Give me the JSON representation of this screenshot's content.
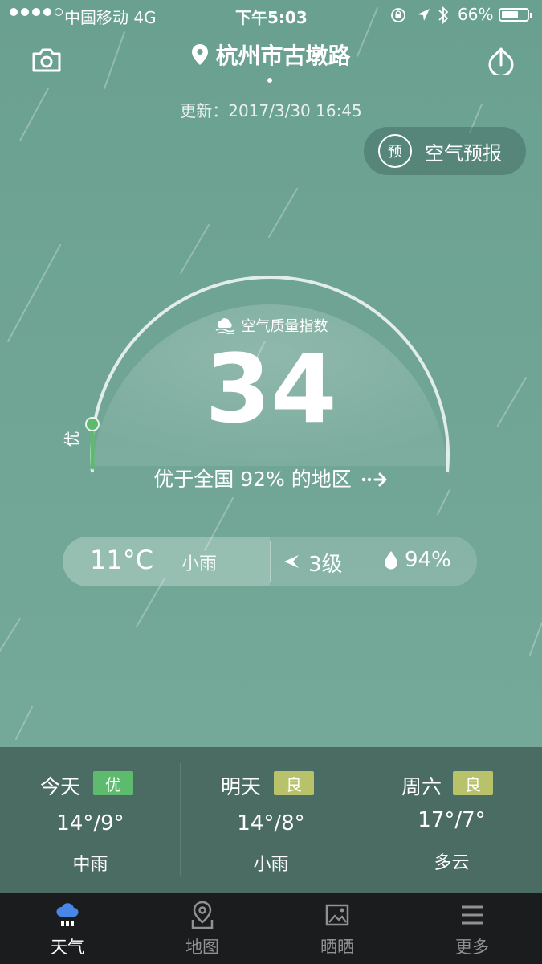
{
  "status_bar": {
    "carrier": "中国移动  4G",
    "time": "下午5:03",
    "battery": "66%",
    "battery_level": 0.66
  },
  "header": {
    "location": "杭州市古墩路",
    "update_time": "更新：2017/3/30 16:45",
    "forecast_button_icon_text": "预",
    "forecast_button_label": "空气预报"
  },
  "aqi": {
    "label": "空气质量指数",
    "value": "34",
    "grade": "优",
    "comparison": "优于全国 92% 的地区"
  },
  "current": {
    "temperature": "11°C",
    "weather": "小雨",
    "wind": "3级",
    "humidity": "94%"
  },
  "forecast": [
    {
      "day": "今天",
      "quality": "优",
      "quality_color": "#5dbb6e",
      "range": "14°/9°",
      "weather": "中雨"
    },
    {
      "day": "明天",
      "quality": "良",
      "quality_color": "#b7c26a",
      "range": "14°/8°",
      "weather": "小雨"
    },
    {
      "day": "周六",
      "quality": "良",
      "quality_color": "#b7c26a",
      "range": "17°/7°",
      "weather": "多云"
    }
  ],
  "tabs": [
    {
      "label": "天气",
      "icon": "weather-cloud-icon",
      "active": true
    },
    {
      "label": "地图",
      "icon": "map-pin-icon",
      "active": false
    },
    {
      "label": "晒晒",
      "icon": "photo-icon",
      "active": false
    },
    {
      "label": "更多",
      "icon": "menu-icon",
      "active": false
    }
  ],
  "colors": {
    "background": "#6ea393",
    "forecast_strip": "#4b6c62",
    "tab_bar": "#1b1c1d",
    "aqi_good": "#5dbb6e",
    "active_tab_icon": "#4a86e8"
  }
}
